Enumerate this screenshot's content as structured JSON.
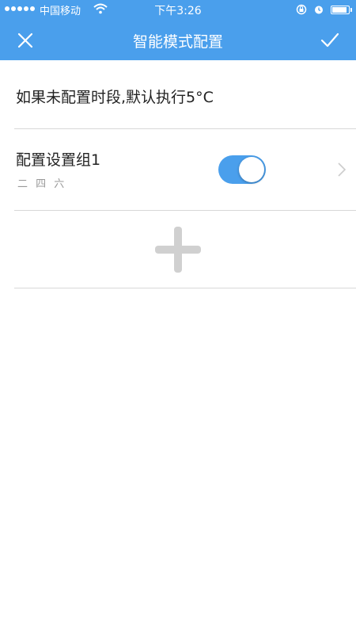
{
  "status_bar": {
    "carrier": "中国移动",
    "time": "下午3:26",
    "battery_level": 1.0
  },
  "header": {
    "title": "智能模式配置",
    "close_icon": "close-icon",
    "confirm_icon": "check-icon"
  },
  "default_note": "如果未配置时段,默认执行5°C",
  "groups": [
    {
      "name": "配置设置组1",
      "days": "二 四 六",
      "enabled": true
    }
  ],
  "add_icon": "plus-icon",
  "colors": {
    "accent": "#4a9fec",
    "divider": "#d8d8d8",
    "secondary_text": "#999999",
    "add_icon": "#d0d0d0"
  }
}
